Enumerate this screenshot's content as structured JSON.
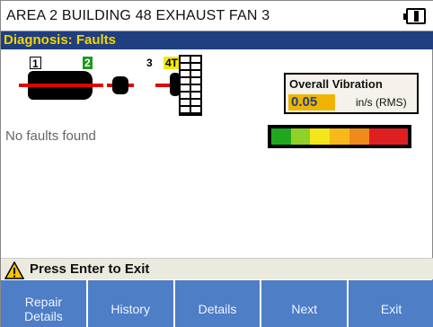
{
  "window": {
    "title": "AREA 2 BUILDING 48 EXHAUST FAN 3",
    "battery_icon": "battery-icon"
  },
  "screen": {
    "subtitle": "Diagnosis: Faults"
  },
  "machine": {
    "labels": [
      "1",
      "2",
      "3",
      "4T"
    ],
    "colors": {
      "coupling_line": "#e00000",
      "label_2_bg": "#1a9a1a",
      "label_4T_bg": "#f5e900"
    }
  },
  "vibration": {
    "title": "Overall Vibration",
    "value": "0.05",
    "unit": "in/s (RMS)",
    "value_bg": "#f0b400"
  },
  "faults": {
    "message": "No faults found"
  },
  "severity_scale": {
    "colors": [
      "#1fa81f",
      "#8fd126",
      "#f3e61a",
      "#f7b81a",
      "#f08a1a",
      "#e02020",
      "#e02020"
    ]
  },
  "prompt": {
    "icon": "warning-icon",
    "text": "Press Enter to Exit"
  },
  "softkeys": [
    {
      "line1": "Repair",
      "line2": "Details"
    },
    {
      "line1": "",
      "line2": "History"
    },
    {
      "line1": "",
      "line2": "Details"
    },
    {
      "line1": "",
      "line2": "Next"
    },
    {
      "line1": "",
      "line2": "Exit"
    }
  ]
}
